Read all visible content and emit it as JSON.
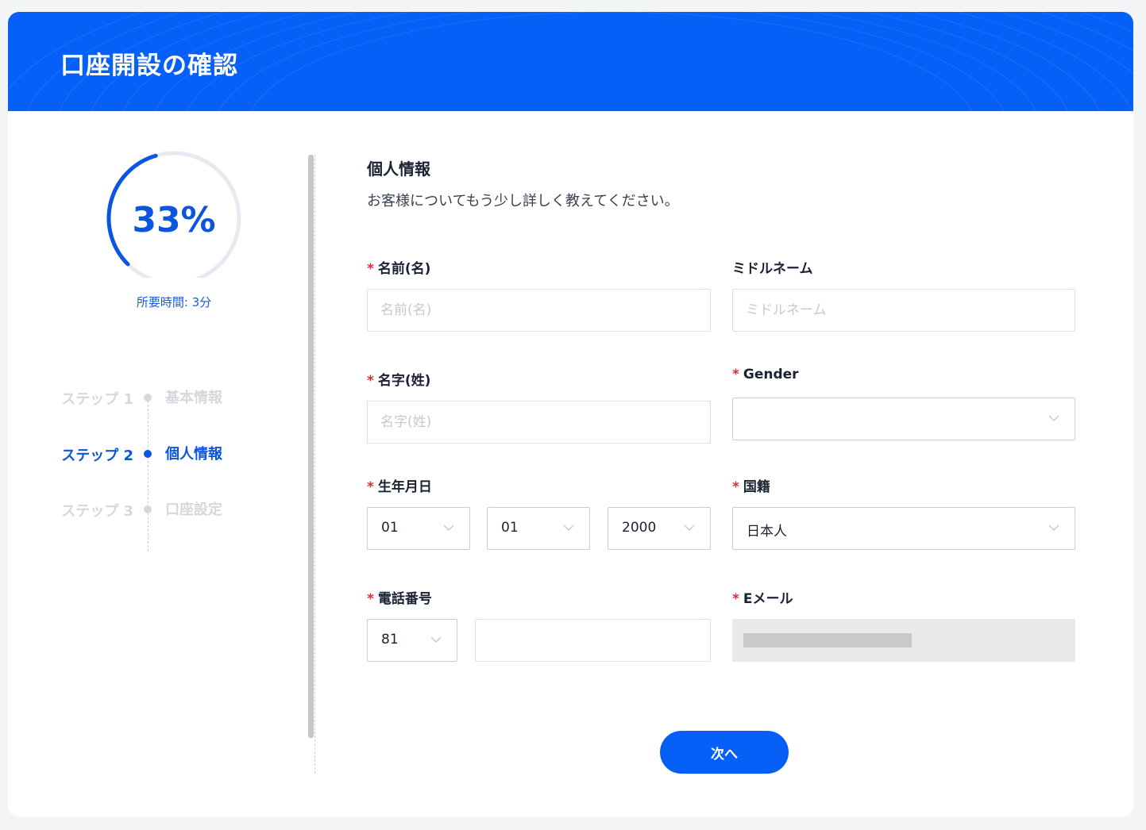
{
  "header": {
    "title": "口座開設の確認"
  },
  "progress": {
    "percent_text": "33%",
    "fraction": 0.33,
    "eta": "所要時間: 3分"
  },
  "steps": [
    {
      "label": "ステップ 1",
      "name": "基本情報",
      "state": "inactive"
    },
    {
      "label": "ステップ 2",
      "name": "個人情報",
      "state": "active"
    },
    {
      "label": "ステップ 3",
      "name": "口座設定",
      "state": "inactive"
    }
  ],
  "form": {
    "title": "個人情報",
    "subtitle": "お客様についてもう少し詳しく教えてください。",
    "required_mark": "*",
    "first_name": {
      "label": "名前(名)",
      "placeholder": "名前(名)",
      "value": ""
    },
    "middle_name": {
      "label": "ミドルネーム",
      "placeholder": "ミドルネーム",
      "value": ""
    },
    "last_name": {
      "label": "名字(姓)",
      "placeholder": "名字(姓)",
      "value": ""
    },
    "gender": {
      "label": "Gender",
      "value": ""
    },
    "birthdate": {
      "label": "生年月日",
      "day": "01",
      "month": "01",
      "year": "2000"
    },
    "nationality": {
      "label": "国籍",
      "value": "日本人"
    },
    "phone": {
      "label": "電話番号",
      "country_code": "81",
      "value": ""
    },
    "email": {
      "label": "Eメール"
    }
  },
  "buttons": {
    "next": "次へ"
  },
  "colors": {
    "brand": "#0660f8",
    "accent_text": "#0b55e0",
    "required": "#e0283a"
  }
}
